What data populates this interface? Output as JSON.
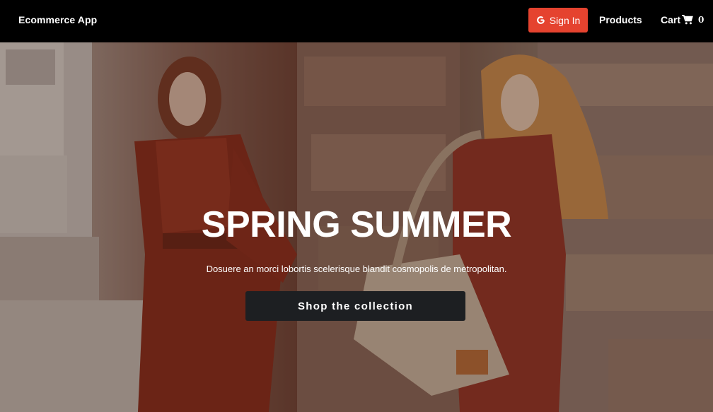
{
  "navbar": {
    "brand": "Ecommerce App",
    "signin_label": "Sign In",
    "signin_icon": "google-icon",
    "products_label": "Products",
    "cart_label": "Cart",
    "cart_icon": "cart-icon",
    "cart_count": "0"
  },
  "hero": {
    "title": "SPRING SUMMER",
    "subtitle": "Dosuere an morci lobortis scelerisque blandit cosmopolis de metropolitan.",
    "cta_label": "Shop the collection"
  },
  "colors": {
    "navbar_bg": "#000000",
    "signin_bg": "#e5432f",
    "cta_bg": "#1d1f22"
  }
}
